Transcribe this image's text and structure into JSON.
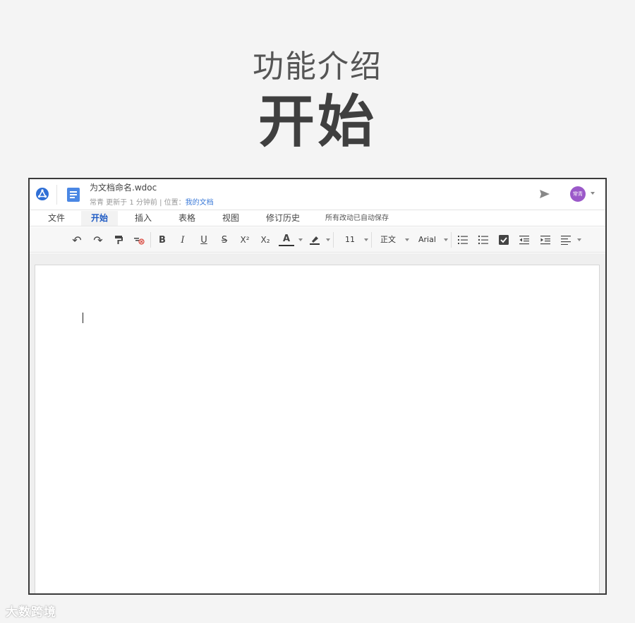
{
  "hero": {
    "subtitle": "功能介绍",
    "title": "开始"
  },
  "titlebar": {
    "doc_name": "为文档命名.wdoc",
    "meta_prefix": "常青  更新于 1 分钟前 | 位置：",
    "meta_location": "我的文档",
    "avatar_text": "常青"
  },
  "menu": {
    "items": [
      "文件",
      "开始",
      "插入",
      "表格",
      "视图",
      "修订历史"
    ],
    "active": "开始",
    "autosave": "所有改动已自动保存"
  },
  "toolbar": {
    "undo": "↶",
    "redo": "↷",
    "bold": "B",
    "italic": "I",
    "underline": "U",
    "strike": "S",
    "superscript": "X²",
    "subscript": "X₂",
    "font_color": "A",
    "font_size": "11",
    "paragraph_style": "正文",
    "font_family": "Arial"
  },
  "colors": {
    "accent": "#1f5bc4",
    "doc_icon": "#4a87e4",
    "logo": "#2f6fd6",
    "avatar": "#9b59c9",
    "font_color_underline": "#c0392b"
  },
  "watermark": "大数跨境"
}
